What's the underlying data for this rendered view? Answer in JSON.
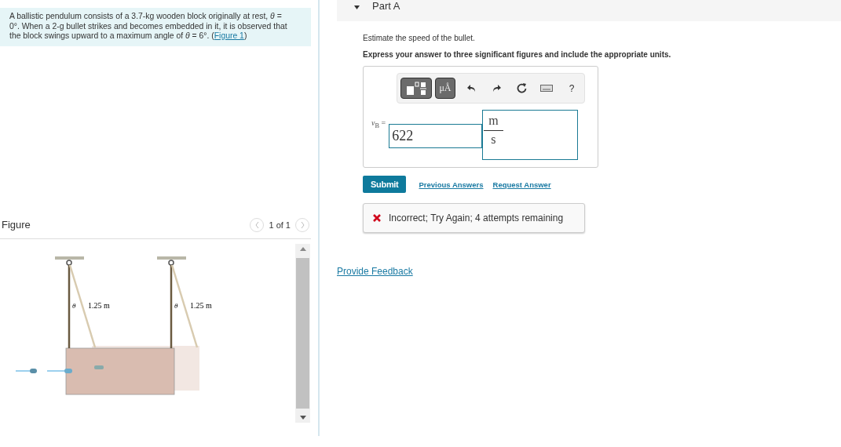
{
  "problem": {
    "text": "A ballistic pendulum consists of a 3.7-kg wooden block originally at rest, *θ* = 0°. When a 2-g bullet strikes and becomes embedded in it, it is observed that the block swings upward to a maximum angle of *θ* = 6°. (",
    "link": "Figure 1",
    "after": ")"
  },
  "figure": {
    "title": "Figure",
    "counter": "1 of 1",
    "labels": [
      {
        "angle": "θ",
        "length": "1.25 m"
      },
      {
        "angle": "θ",
        "length": "1.25 m"
      }
    ]
  },
  "part": {
    "title": "Part A",
    "expanded": true
  },
  "question": "Estimate the speed of the bullet.",
  "instruction": "Express your answer to three significant figures and include the appropriate units.",
  "toolbar": [
    {
      "kind": "templates"
    },
    {
      "kind": "units",
      "label": "μÅ"
    },
    {
      "kind": "undo"
    },
    {
      "kind": "redo"
    },
    {
      "kind": "reset"
    },
    {
      "kind": "keyboard"
    },
    {
      "kind": "help",
      "label": "?"
    }
  ],
  "answer": {
    "variable": "*v*$_{B}$ =",
    "value": "622",
    "unit_numerator": "m",
    "unit_denominator": "s"
  },
  "actions": {
    "submit": "Submit",
    "links": [
      "Previous Answers",
      "Request Answer"
    ]
  },
  "feedback": {
    "correct": false,
    "text": "Incorrect; Try Again; 4 attempts remaining"
  },
  "provide_feedback": "Provide Feedback"
}
